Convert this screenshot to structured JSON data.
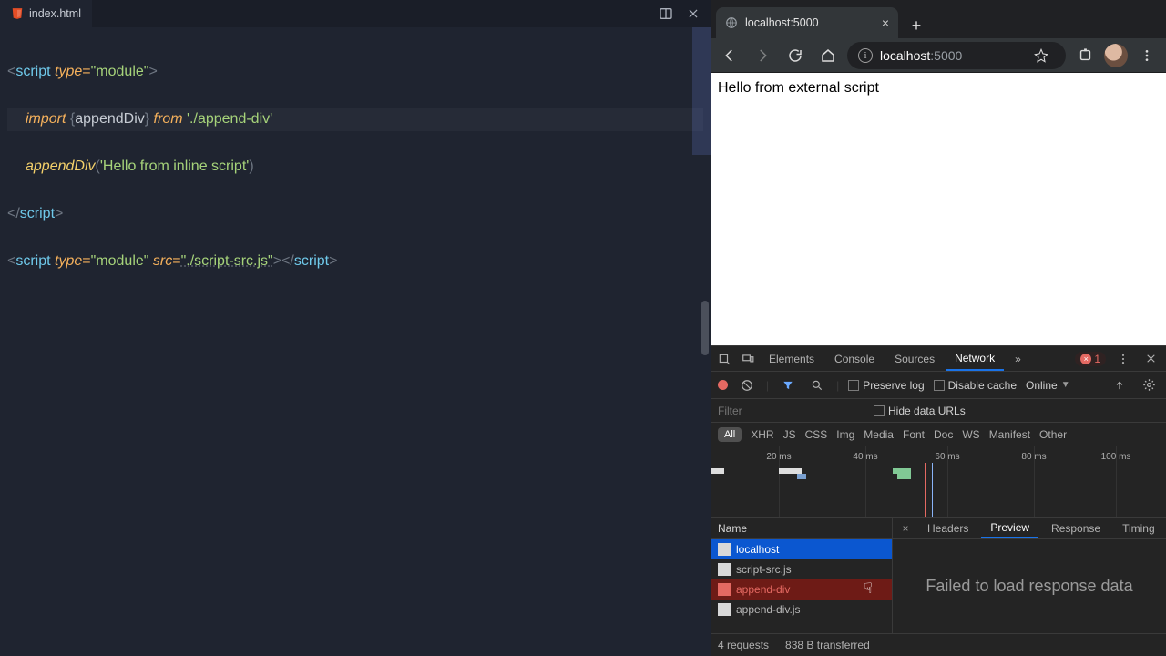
{
  "editor": {
    "tab_filename": "index.html",
    "code": {
      "l1": {
        "open": "<",
        "tag": "script",
        "sp": " ",
        "attr": "type",
        "eq": "=",
        "str": "\"module\"",
        "close": ">"
      },
      "l2": {
        "kw": "import",
        "sp": " ",
        "brace_o": "{",
        "name": "appendDiv",
        "brace_c": "}",
        "sp2": " ",
        "from": "from",
        "sp3": " ",
        "str": "'./append-div'"
      },
      "l3": {
        "fn": "appendDiv",
        "paren_o": "(",
        "str": "'Hello from inline script'",
        "paren_c": ")"
      },
      "l4": {
        "open": "</",
        "tag": "script",
        "close": ">"
      },
      "l5": {
        "open": "<",
        "tag": "script",
        "sp": " ",
        "attr1": "type",
        "eq": "=",
        "str1": "\"module\"",
        "sp2": " ",
        "attr2": "src",
        "eq2": "=",
        "str2": "\"./script-src.js\"",
        "mid": "></",
        "tag2": "script",
        "close": ">"
      }
    }
  },
  "browser": {
    "tab_title": "localhost:5000",
    "url_host": "localhost",
    "url_port": ":5000",
    "page_text": "Hello from external script"
  },
  "devtools": {
    "tabs": {
      "elements": "Elements",
      "console": "Console",
      "sources": "Sources",
      "network": "Network"
    },
    "error_count": "1",
    "toolbar": {
      "preserve": "Preserve log",
      "disable_cache": "Disable cache",
      "online": "Online"
    },
    "filter_ph": "Filter",
    "hide_urls": "Hide data URLs",
    "types": {
      "all": "All",
      "xhr": "XHR",
      "js": "JS",
      "css": "CSS",
      "img": "Img",
      "media": "Media",
      "font": "Font",
      "doc": "Doc",
      "ws": "WS",
      "manifest": "Manifest",
      "other": "Other"
    },
    "timeline_ticks": [
      "20 ms",
      "40 ms",
      "60 ms",
      "80 ms",
      "100 ms"
    ],
    "name_header": "Name",
    "requests": [
      {
        "name": "localhost",
        "sel": "blue"
      },
      {
        "name": "script-src.js",
        "sel": ""
      },
      {
        "name": "append-div",
        "sel": "red"
      },
      {
        "name": "append-div.js",
        "sel": ""
      }
    ],
    "detail_tabs": {
      "headers": "Headers",
      "preview": "Preview",
      "response": "Response",
      "timing": "Timing"
    },
    "detail_message": "Failed to load response data",
    "status": {
      "reqs": "4 requests",
      "xfer": "838 B transferred"
    }
  }
}
